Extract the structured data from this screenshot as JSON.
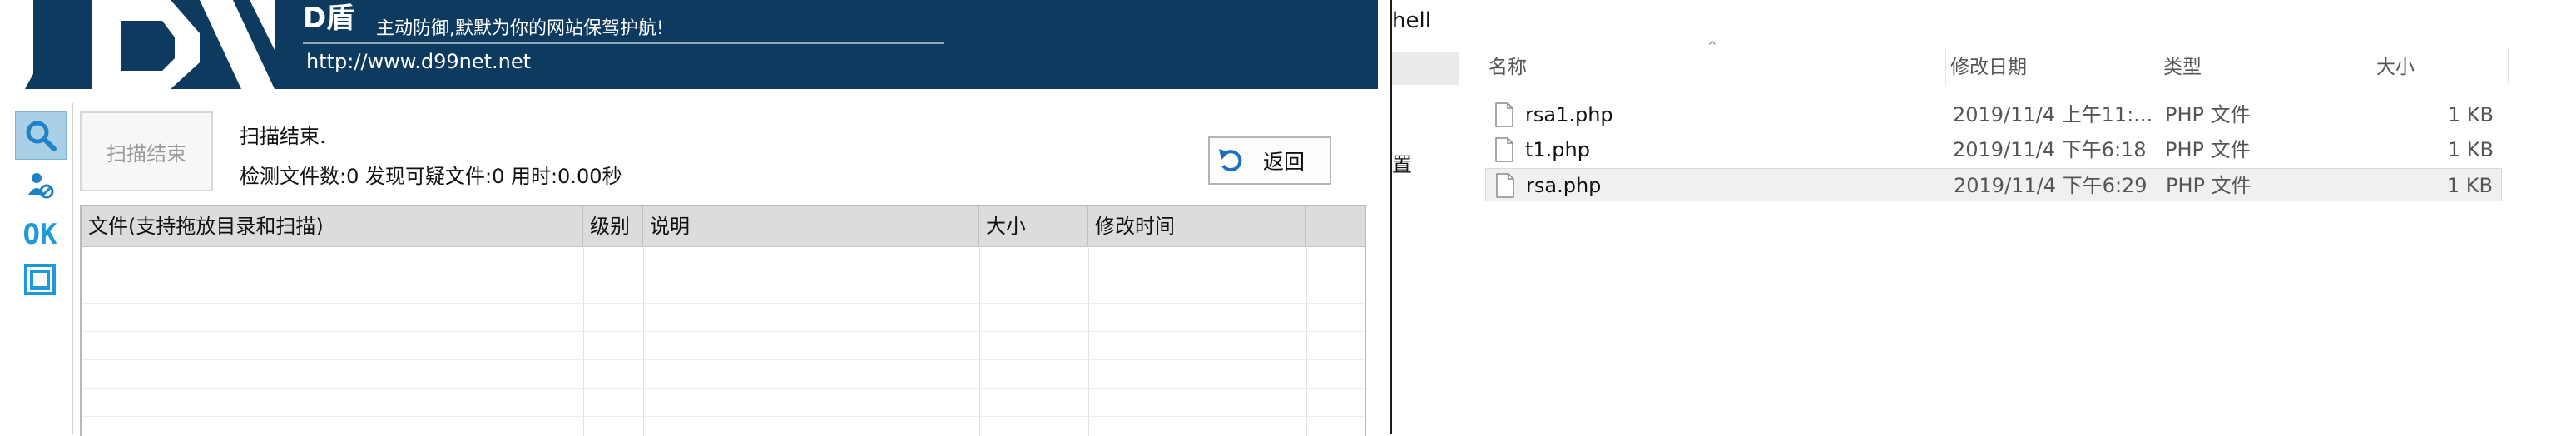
{
  "dshield": {
    "brand": "D盾",
    "slogan": "主动防御,默默为你的网站保驾护航!",
    "url": "http://www.d99net.net",
    "tools": [
      {
        "icon": "search-icon"
      },
      {
        "icon": "user-shield-icon"
      },
      {
        "label": "OK",
        "icon": "ok-icon"
      },
      {
        "icon": "frame-icon"
      }
    ],
    "scan_button": "扫描结束",
    "status": "扫描结束.",
    "stats": "检测文件数:0 发现可疑文件:0 用时:0.00秒",
    "back_button": "返回",
    "columns": [
      "文件(支持拖放目录和扫描)",
      "级别",
      "说明",
      "大小",
      "修改时间"
    ],
    "colors": {
      "banner": "#0d3a5e",
      "accent": "#1e9ad8"
    }
  },
  "explorer": {
    "address": "hell",
    "nav_label": "置",
    "columns": [
      "名称",
      "修改日期",
      "类型",
      "大小"
    ],
    "files": [
      {
        "name": "rsa1.php",
        "modified": "2019/11/4 上午11:...",
        "type": "PHP 文件",
        "size": "1 KB"
      },
      {
        "name": "t1.php",
        "modified": "2019/11/4 下午6:18",
        "type": "PHP 文件",
        "size": "1 KB"
      },
      {
        "name": "rsa.php",
        "modified": "2019/11/4 下午6:29",
        "type": "PHP 文件",
        "size": "1 KB"
      }
    ]
  }
}
